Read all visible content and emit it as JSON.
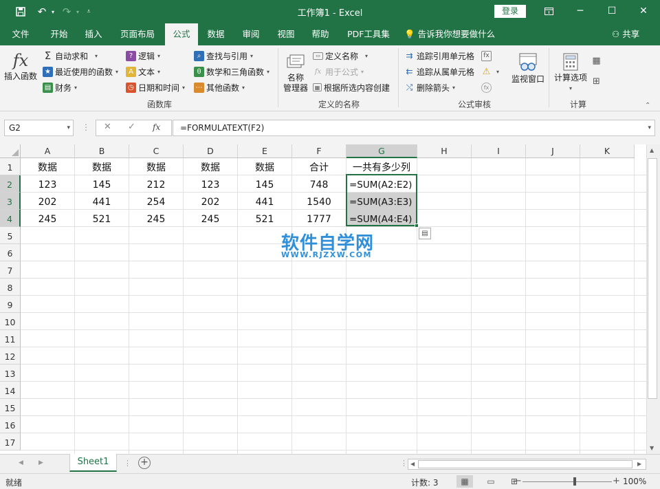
{
  "window": {
    "title": "工作簿1 - Excel",
    "login_label": "登录",
    "share_label": "共享"
  },
  "menu_tabs": [
    "文件",
    "开始",
    "插入",
    "页面布局",
    "公式",
    "数据",
    "审阅",
    "视图",
    "帮助",
    "PDF工具集"
  ],
  "active_tab": "公式",
  "tell_me": "告诉我你想要做什么",
  "ribbon": {
    "insert_function": "插入函数",
    "library": {
      "autosum": "自动求和",
      "recent": "最近使用的函数",
      "financial": "财务",
      "logical": "逻辑",
      "text": "文本",
      "datetime": "日期和时间",
      "lookup": "查找与引用",
      "math": "数学和三角函数",
      "more": "其他函数",
      "group_label": "函数库"
    },
    "names": {
      "manager_line1": "名称",
      "manager_line2": "管理器",
      "define": "定义名称",
      "use_in_formula": "用于公式",
      "create_from_selection": "根据所选内容创建",
      "group_label": "定义的名称"
    },
    "audit": {
      "trace_precedents": "追踪引用单元格",
      "trace_dependents": "追踪从属单元格",
      "remove_arrows": "删除箭头",
      "watch_window": "监视窗口",
      "group_label": "公式审核"
    },
    "calc": {
      "options": "计算选项",
      "group_label": "计算"
    }
  },
  "formula_bar": {
    "name_box": "G2",
    "formula": "=FORMULATEXT(F2)",
    "fx": "fx"
  },
  "columns": [
    "A",
    "B",
    "C",
    "D",
    "E",
    "F",
    "G",
    "H",
    "I",
    "J",
    "K"
  ],
  "rows": [
    "1",
    "2",
    "3",
    "4",
    "5",
    "6",
    "7",
    "8",
    "9",
    "10",
    "11",
    "12",
    "13",
    "14",
    "15",
    "16",
    "17"
  ],
  "cells": {
    "row1": [
      "数据",
      "数据",
      "数据",
      "数据",
      "数据",
      "合计",
      "一共有多少列"
    ],
    "row2": [
      "123",
      "145",
      "212",
      "123",
      "145",
      "748",
      "=SUM(A2:E2)"
    ],
    "row3": [
      "202",
      "441",
      "254",
      "202",
      "441",
      "1540",
      "=SUM(A3:E3)"
    ],
    "row4": [
      "245",
      "521",
      "245",
      "245",
      "521",
      "1777",
      "=SUM(A4:E4)"
    ]
  },
  "watermark": {
    "main": "软件自学网",
    "sub": "WWW.RJZXW.COM"
  },
  "sheet_tab": "Sheet1",
  "status": {
    "ready": "就绪",
    "count": "计数: 3",
    "zoom": "100%"
  },
  "accent_color": "#217346"
}
